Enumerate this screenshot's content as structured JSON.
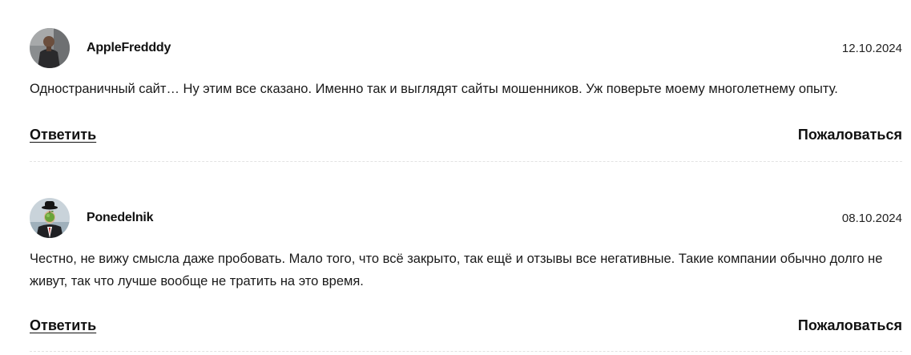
{
  "comments": [
    {
      "author": "AppleFredddy",
      "date": "12.10.2024",
      "text": "Одностраничный сайт… Ну этим все сказано. Именно так и выглядят сайты мошенников. Уж поверьте моему многолетнему опыту.",
      "reply_label": "Ответить",
      "report_label": "Пожаловаться",
      "avatar_icon": "user-photo-avatar"
    },
    {
      "author": "Ponedelnik",
      "date": "08.10.2024",
      "text": "Честно, не вижу смысла даже пробовать. Мало того, что всё закрыто, так ещё и отзывы все негативные. Такие компании обычно долго не живут, так что лучше вообще не тратить на это время.",
      "reply_label": "Ответить",
      "report_label": "Пожаловаться",
      "avatar_icon": "magritte-apple-avatar"
    }
  ],
  "colors": {
    "text": "#1a1a1a",
    "divider": "#e2e2e2",
    "background": "#ffffff"
  }
}
